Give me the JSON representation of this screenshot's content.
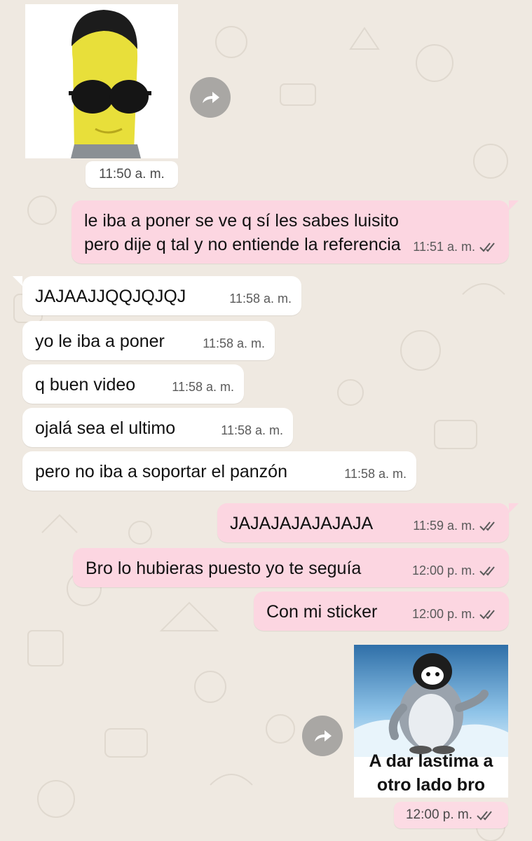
{
  "colors": {
    "wallpaper": "#efe9e1",
    "incoming": "#ffffff",
    "outgoing": "#fcd6e1",
    "tick": "#5a5a5a"
  },
  "sticker_top": {
    "kind": "image",
    "icon": "banana-man-sunglasses-sticker",
    "time": "11:50 a. m."
  },
  "messages": [
    {
      "dir": "out",
      "text": "le iba a poner se ve q sí les sabes luisito pero dije q tal y no entiende la referencia",
      "time": "11:51 a. m.",
      "status": "read"
    },
    {
      "dir": "in",
      "text": "JAJAAJJQQJQJQJ",
      "time": "11:58 a. m."
    },
    {
      "dir": "in",
      "text": "yo le iba a poner",
      "time": "11:58 a. m."
    },
    {
      "dir": "in",
      "text": "q buen video",
      "time": "11:58 a. m."
    },
    {
      "dir": "in",
      "text": "ojalá sea el ultimo",
      "time": "11:58 a. m."
    },
    {
      "dir": "in",
      "text": "pero no iba a soportar el panzón",
      "time": "11:58 a. m."
    },
    {
      "dir": "out",
      "text": "JAJAJAJAJAJAJA",
      "time": "11:59 a. m.",
      "status": "read"
    },
    {
      "dir": "out",
      "text": "Bro lo hubieras puesto yo te seguía",
      "time": "12:00 p. m.",
      "status": "read"
    },
    {
      "dir": "out",
      "text": "Con mi sticker",
      "time": "12:00 p. m.",
      "status": "read"
    }
  ],
  "sticker_bottom": {
    "kind": "image",
    "icon": "penguin-sticker",
    "caption_line1": "A dar lastima a",
    "caption_line2": "otro lado bro",
    "time": "12:00 p. m.",
    "status": "read"
  },
  "forward_icon": "forward-arrow-icon"
}
